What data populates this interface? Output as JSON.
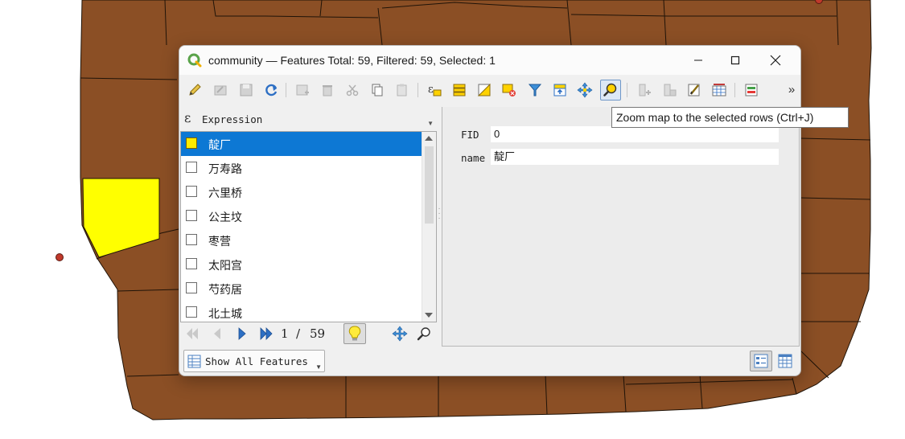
{
  "colors": {
    "map_fill": "#8b4f25",
    "map_border": "#1f1308",
    "map_selected": "#ffff00",
    "selection_row": "#0d78d4",
    "window_bg": "#f0f0f0",
    "qgis_green": "#5aa34a"
  },
  "window": {
    "title": "community — Features Total: 59, Filtered: 59, Selected: 1",
    "minimize_icon": "minimize-icon",
    "maximize_icon": "maximize-icon",
    "close_icon": "close-icon"
  },
  "toolbar": {
    "overflow_label": "»",
    "buttons": [
      {
        "icon": "pencil-icon"
      },
      {
        "icon": "toggle-multi-edit-icon"
      },
      {
        "icon": "save-icon"
      },
      {
        "icon": "refresh-icon"
      },
      {
        "icon": "add-feature-icon"
      },
      {
        "icon": "delete-icon"
      },
      {
        "icon": "cut-icon"
      },
      {
        "icon": "copy-icon"
      },
      {
        "icon": "paste-icon"
      },
      {
        "icon": "select-by-expression-icon"
      },
      {
        "icon": "select-all-icon"
      },
      {
        "icon": "invert-selection-icon"
      },
      {
        "icon": "deselect-icon"
      },
      {
        "icon": "filter-icon"
      },
      {
        "icon": "move-selection-top-icon"
      },
      {
        "icon": "pan-to-selection-icon"
      },
      {
        "icon": "zoom-to-selection-icon"
      },
      {
        "icon": "new-field-icon"
      },
      {
        "icon": "delete-field-icon"
      },
      {
        "icon": "field-calculator-icon"
      },
      {
        "icon": "conditional-formatting-icon"
      },
      {
        "icon": "actions-icon"
      }
    ]
  },
  "tooltip": {
    "text": "Zoom map to the selected rows (Ctrl+J)"
  },
  "left_panel": {
    "expression_icon": "ε",
    "expression_label": "Expression",
    "items": [
      {
        "label": "靛厂",
        "selected": true
      },
      {
        "label": "万寿路",
        "selected": false
      },
      {
        "label": "六里桥",
        "selected": false
      },
      {
        "label": "公主坟",
        "selected": false
      },
      {
        "label": "枣营",
        "selected": false
      },
      {
        "label": "太阳宫",
        "selected": false
      },
      {
        "label": "芍药居",
        "selected": false
      },
      {
        "label": "北土城",
        "selected": false
      }
    ]
  },
  "form": {
    "fields": [
      {
        "label": "FID",
        "value": "0"
      },
      {
        "label": "name",
        "value": "靛厂"
      }
    ]
  },
  "navigation": {
    "current_page": "1",
    "separator": "/",
    "total_pages": "59"
  },
  "bottom": {
    "filter_label": "Show All Features"
  }
}
